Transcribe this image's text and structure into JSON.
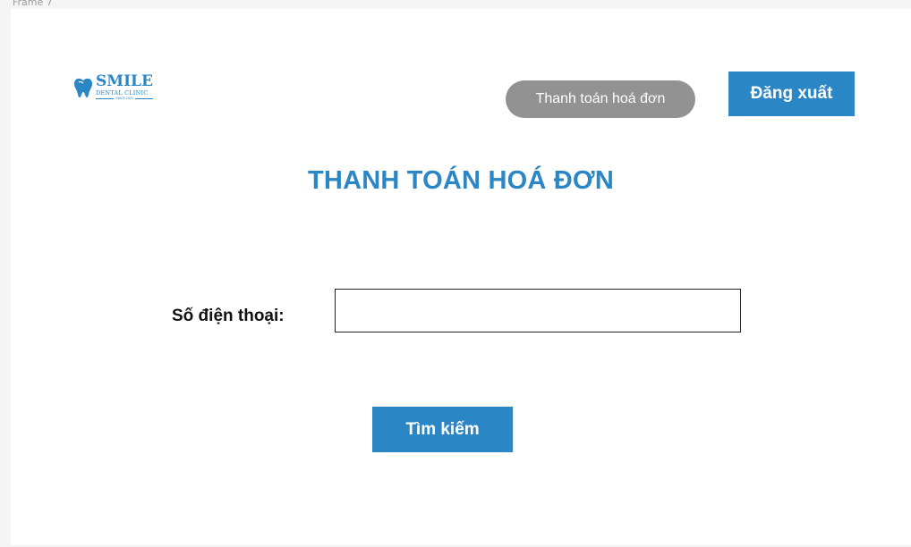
{
  "frame": {
    "label": "Frame 7"
  },
  "brand": {
    "name": "SMILE",
    "subtitle": "DENTAL CLINIC",
    "since": "SINCE 2023",
    "icon": "tooth-icon",
    "color": "#2b86c5"
  },
  "nav": {
    "active_item": "Thanh toán hoá đơn",
    "active_color": "#929292"
  },
  "header": {
    "logout_label": "Đăng xuất"
  },
  "main": {
    "title": "THANH TOÁN HOÁ ĐƠN",
    "phone_label": "Số điện thoại:",
    "phone_value": "",
    "search_label": "Tìm kiếm"
  },
  "colors": {
    "accent": "#2b86c5",
    "background": "#ffffff",
    "canvas": "#f5f5f5"
  }
}
